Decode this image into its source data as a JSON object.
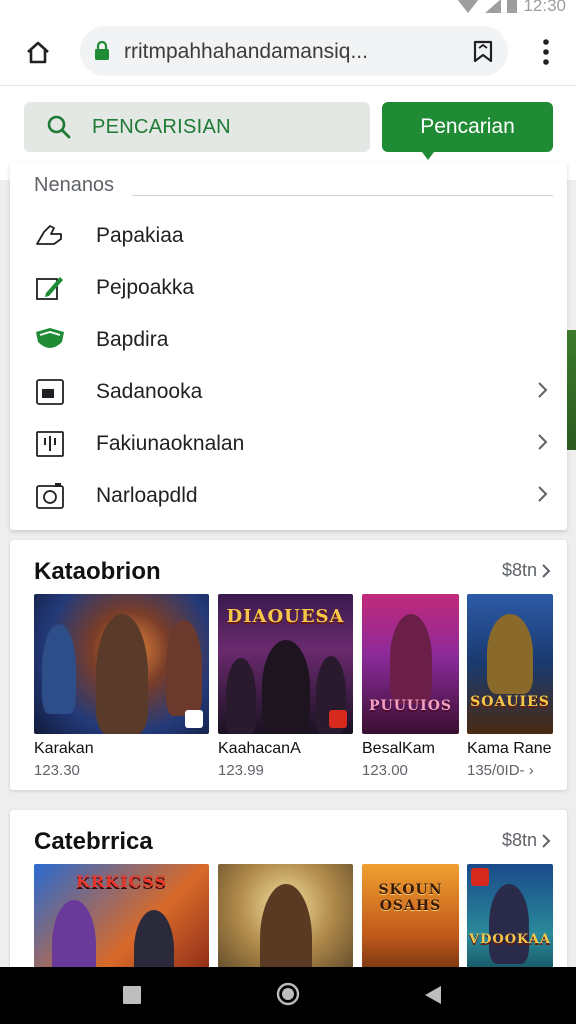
{
  "status_bar": {
    "time": "12:30"
  },
  "browser": {
    "url": "rritmpahhahandamansiq...",
    "icons": {
      "home": "home-icon",
      "lock": "lock-icon",
      "bookmark": "bookmark-icon",
      "more": "more-vert-icon"
    }
  },
  "search": {
    "placeholder": "PENCARISIAN",
    "button_label": "Pencarian",
    "accent_color": "#1f8c35"
  },
  "menu": {
    "header": "Nenanos",
    "items": [
      {
        "label": "Papakiaa",
        "icon": "hand-icon",
        "chevron": false
      },
      {
        "label": "Pejpoakka",
        "icon": "edit-icon",
        "chevron": false
      },
      {
        "label": "Bapdira",
        "icon": "shield-icon",
        "chevron": false
      },
      {
        "label": "Sadanooka",
        "icon": "folder-icon",
        "chevron": true
      },
      {
        "label": "Fakiunaoknalan",
        "icon": "chart-icon",
        "chevron": true
      },
      {
        "label": "Narloapdld",
        "icon": "camera-icon",
        "chevron": true
      }
    ]
  },
  "sections": [
    {
      "title": "Kataobrion",
      "more_label": "$8tn",
      "tiles": [
        {
          "name": "Karakan",
          "meta": "123.30",
          "art_title": ""
        },
        {
          "name": "KaahacanA",
          "meta": "123.99",
          "art_title": "DIAOUESA"
        },
        {
          "name": "BesalKam",
          "meta": "123.00",
          "art_title": "PUUUIOS"
        },
        {
          "name": "Kama Rane",
          "meta": "135/0ID- ›",
          "art_title": "SOAUIES"
        }
      ]
    },
    {
      "title": "Catebrrica",
      "more_label": "$8tn",
      "tiles": [
        {
          "name": "",
          "meta": "",
          "art_title": "KRKICSS"
        },
        {
          "name": "",
          "meta": "",
          "art_title": ""
        },
        {
          "name": "",
          "meta": "",
          "art_title": "SKOUN OSAHS"
        },
        {
          "name": "",
          "meta": "",
          "art_title": "VDOOKAA"
        }
      ]
    }
  ]
}
